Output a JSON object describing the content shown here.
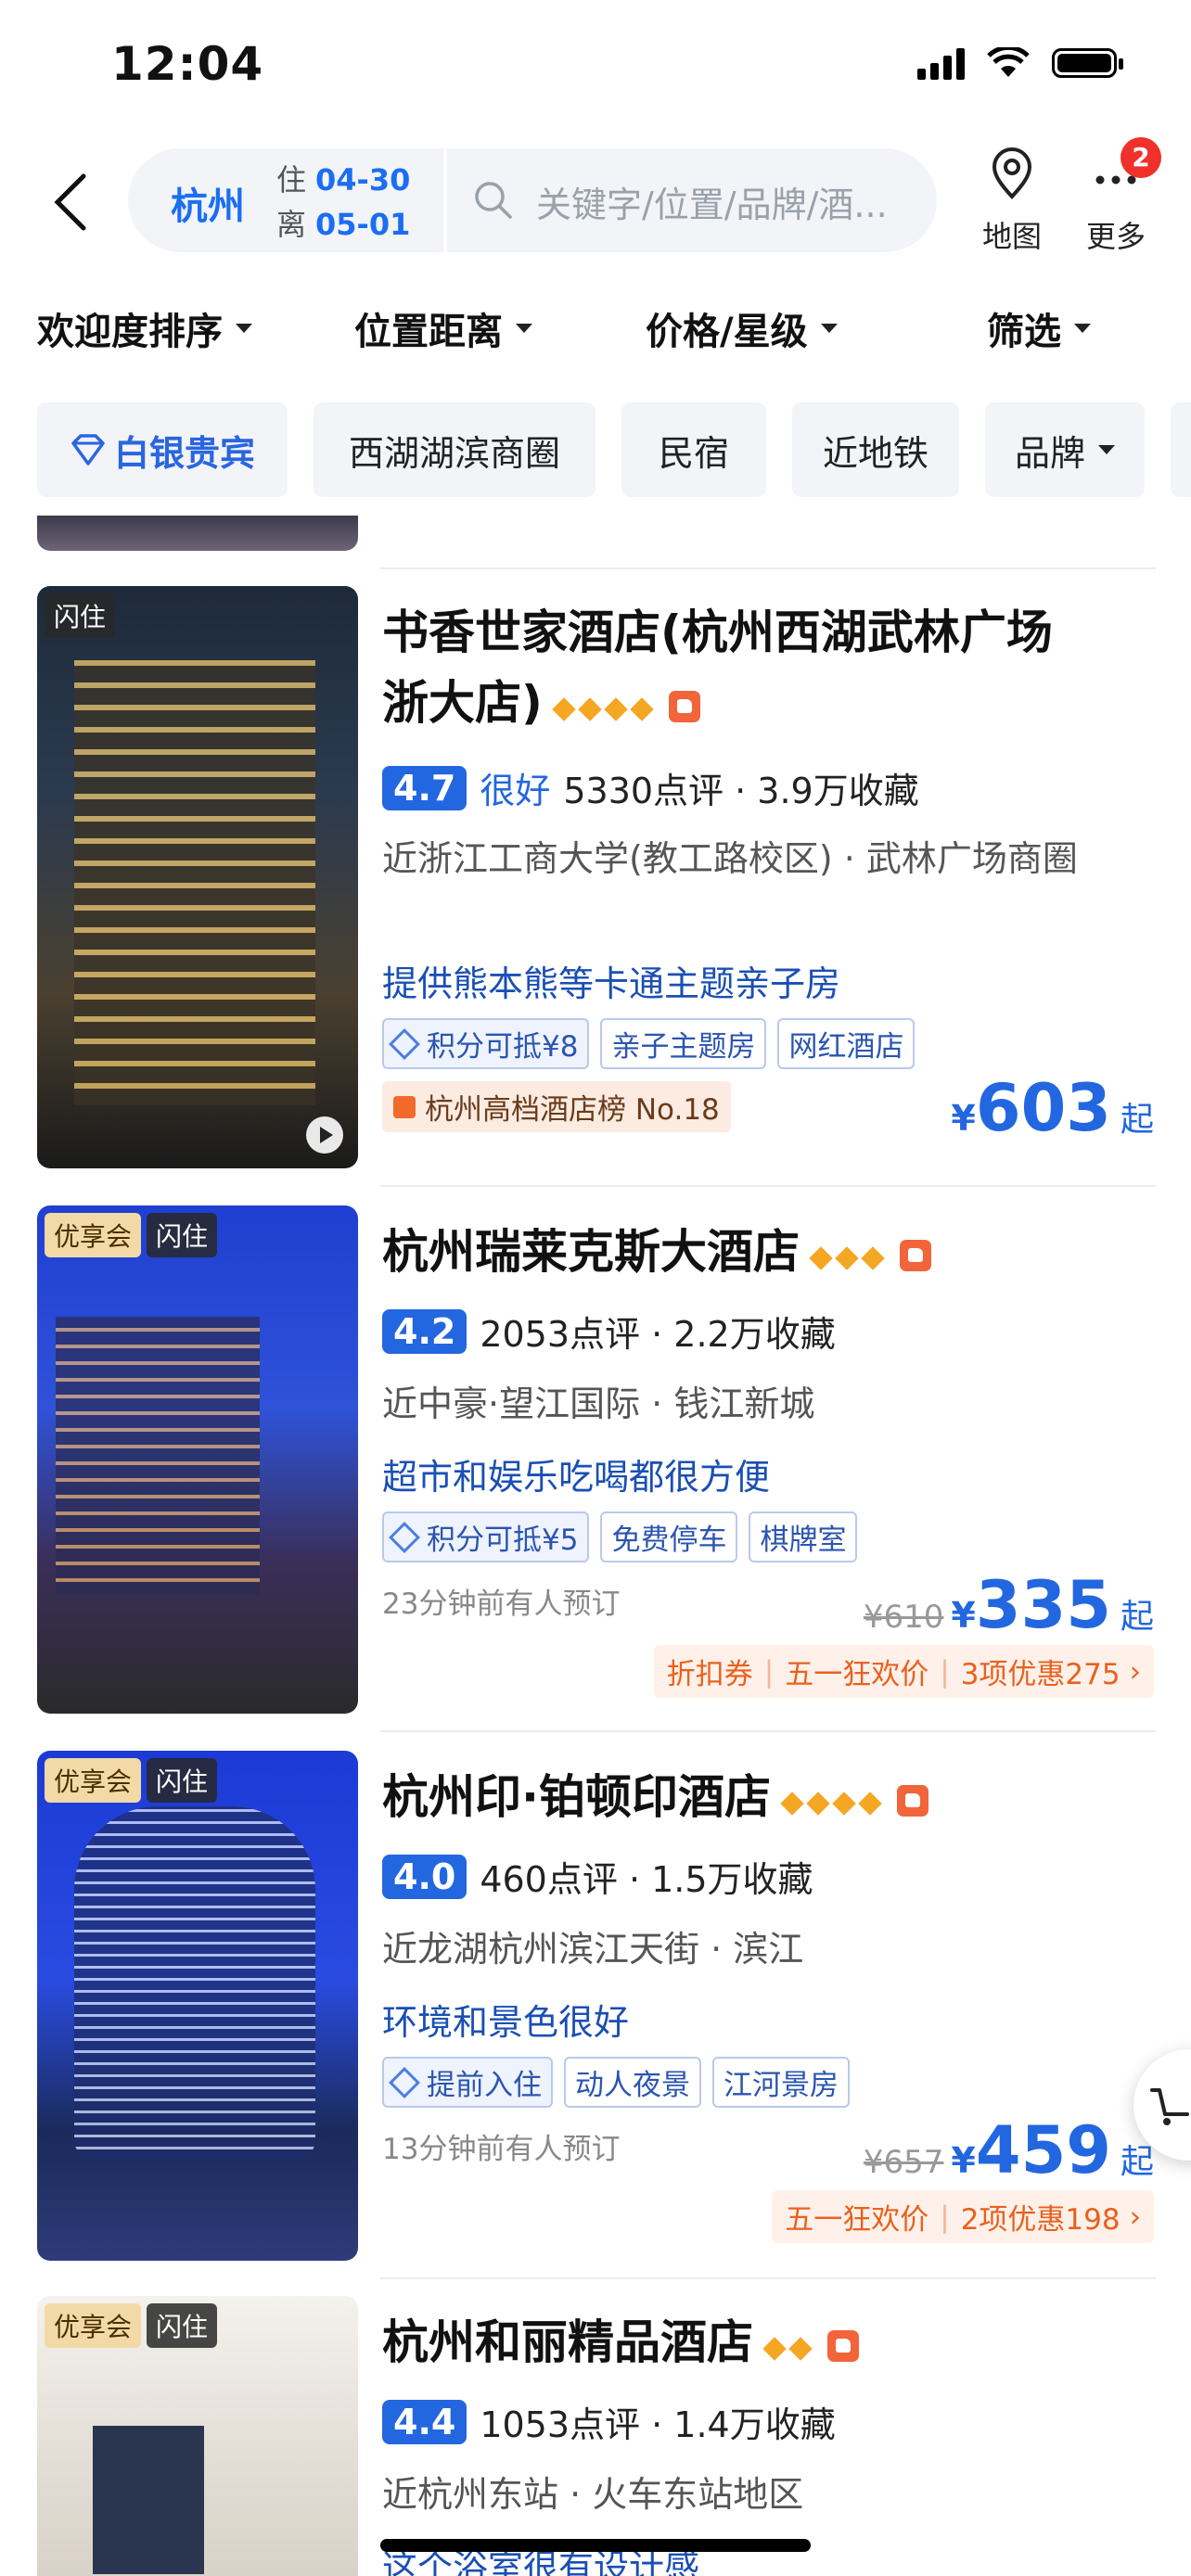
{
  "status_bar": {
    "time": "12:04"
  },
  "search": {
    "city": "杭州",
    "checkin_label": "住",
    "checkin_date": "04-30",
    "checkout_label": "离",
    "checkout_date": "05-01",
    "placeholder": "关键字/位置/品牌/酒..."
  },
  "header_actions": {
    "map_label": "地图",
    "more_label": "更多",
    "more_badge": "2"
  },
  "sort_bar": [
    "欢迎度排序",
    "位置距离",
    "价格/星级",
    "筛选"
  ],
  "quick_filters": [
    "白银贵宾",
    "西湖湖滨商圈",
    "民宿",
    "近地铁",
    "品牌"
  ],
  "hotels": [
    {
      "badges": [
        "闪住"
      ],
      "name_line1": "书香世家酒店(杭州西湖武林广场",
      "name_line2": "浙大店)",
      "star_count": 4,
      "score": "4.7",
      "rating_word": "很好",
      "reviews": "5330点评 · 3.9万收藏",
      "location": "近浙江工商大学(教工路校区) · 武林广场商圈",
      "feature": "提供熊本熊等卡通主题亲子房",
      "tags": [
        "积分可抵¥8",
        "亲子主题房",
        "网红酒店"
      ],
      "rank": "杭州高档酒店榜 No.18",
      "price": "603",
      "price_suffix": "起"
    },
    {
      "badges": [
        "优享会",
        "闪住"
      ],
      "name_line1": "杭州瑞莱克斯大酒店",
      "star_count": 3,
      "score": "4.2",
      "reviews": "2053点评 · 2.2万收藏",
      "location": "近中豪·望江国际 · 钱江新城",
      "feature": "超市和娱乐吃喝都很方便",
      "tags": [
        "积分可抵¥5",
        "免费停车",
        "棋牌室"
      ],
      "booked": "23分钟前有人预订",
      "orig_price": "¥610",
      "price": "335",
      "price_suffix": "起",
      "promos": [
        "折扣券",
        "五一狂欢价",
        "3项优惠275"
      ]
    },
    {
      "badges": [
        "优享会",
        "闪住"
      ],
      "name_line1": "杭州印·铂顿印酒店",
      "star_count": 4,
      "score": "4.0",
      "reviews": "460点评 · 1.5万收藏",
      "location": "近龙湖杭州滨江天街 · 滨江",
      "feature": "环境和景色很好",
      "tags": [
        "提前入住",
        "动人夜景",
        "江河景房"
      ],
      "booked": "13分钟前有人预订",
      "orig_price": "¥657",
      "price": "459",
      "price_suffix": "起",
      "promos": [
        "五一狂欢价",
        "2项优惠198"
      ]
    },
    {
      "badges": [
        "优享会",
        "闪住"
      ],
      "name_line1": "杭州和丽精品酒店",
      "star_count": 2,
      "score": "4.4",
      "reviews": "1053点评 · 1.4万收藏",
      "location": "近杭州东站 · 火车东站地区",
      "feature": "这个浴室很有设计感"
    }
  ],
  "colors": {
    "accent": "#2367e0",
    "promo": "#e9611d",
    "star": "#f5a623"
  }
}
